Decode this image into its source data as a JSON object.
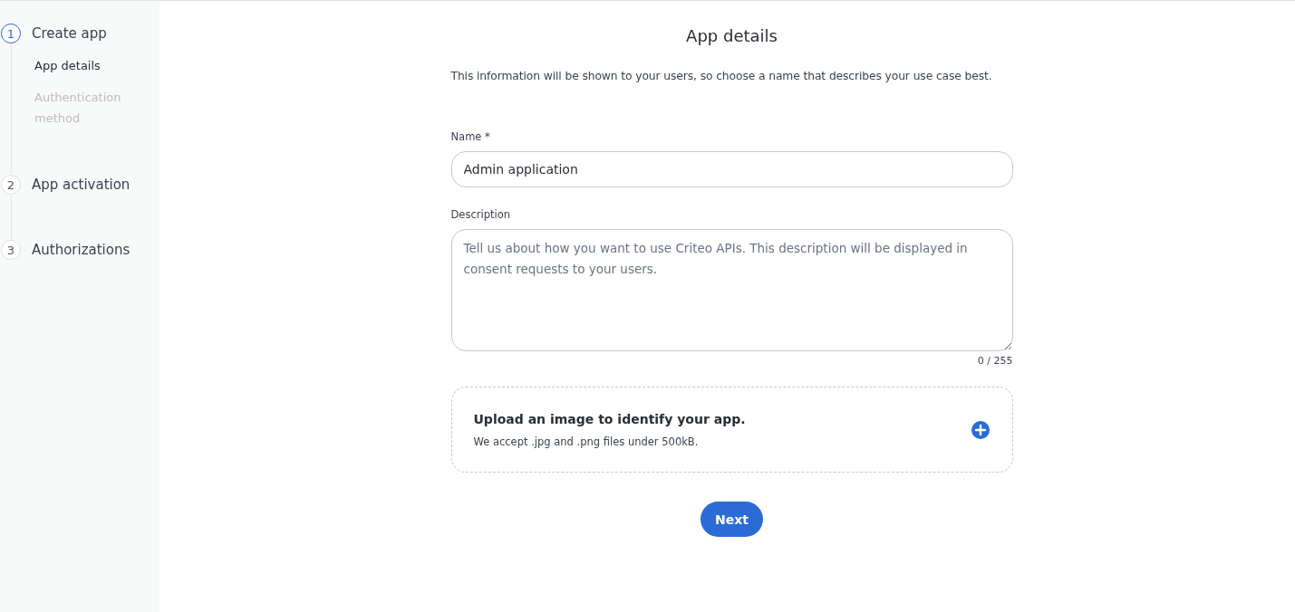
{
  "stepper": {
    "steps": [
      {
        "number": "1",
        "label": "Create app",
        "selected": true,
        "substeps": [
          {
            "label": "App details",
            "selected": true
          },
          {
            "label": "Authentication method",
            "selected": false
          }
        ]
      },
      {
        "number": "2",
        "label": "App activation",
        "selected": false
      },
      {
        "number": "3",
        "label": "Authorizations",
        "selected": false
      }
    ]
  },
  "form": {
    "title": "App details",
    "intro": "This information will be shown to your users, so choose a name that describes your use case best.",
    "name_field": {
      "label": "Name *",
      "value": "Admin application"
    },
    "description_field": {
      "label": "Description",
      "placeholder": "Tell us about how you want to use Criteo APIs. This description will be displayed in consent requests to your users.",
      "counter": "0 / 255"
    },
    "upload": {
      "title": "Upload an image to identify your app.",
      "hint": "We accept .jpg and .png files under 500kB."
    },
    "next_button": "Next"
  }
}
